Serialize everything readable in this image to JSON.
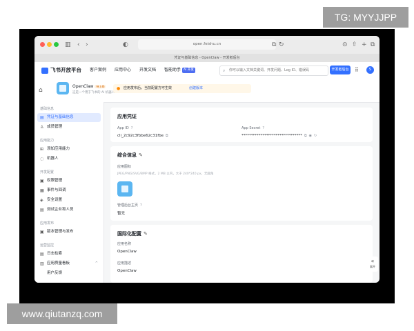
{
  "watermarks": {
    "top": "TG: MYYJJPP",
    "bottom": "www.qiutanzq.com"
  },
  "browser": {
    "url": "open.feishu.cn",
    "tab_title": "凭证与基础信息 - OpenClaw - 开发者后台",
    "icons": [
      "sidebar-icon",
      "back-icon",
      "forward-icon",
      "shield-icon",
      "translate-icon",
      "reload-icon",
      "download-icon",
      "share-icon",
      "new-tab-icon",
      "tabs-icon"
    ]
  },
  "header": {
    "logo": "飞书开放平台",
    "nav": [
      "客户案例",
      "应用中心",
      "开发文档",
      "智能助手"
    ],
    "ai_badge": "AI 开发",
    "search_placeholder": "你可以输入文档关键词、开发问题、Log ID、错误码",
    "console_button": "开发者后台",
    "avatar": "S"
  },
  "app": {
    "name": "OpenClaw",
    "tag": "待上线",
    "desc": "这是一个用于飞书的 AI 机器人",
    "notice": "应用发布后，当前配置方可生效",
    "notice_link": "创建版本"
  },
  "sidebar": {
    "groups": [
      {
        "title": "基础信息",
        "items": [
          {
            "label": "凭证与基础信息",
            "icon": "▤",
            "active": true
          },
          {
            "label": "成员管理",
            "icon": "♙"
          }
        ]
      },
      {
        "title": "应用能力",
        "items": [
          {
            "label": "添加应用能力",
            "icon": "⊞"
          },
          {
            "label": "机器人",
            "icon": "◌"
          }
        ]
      },
      {
        "title": "开发配置",
        "items": [
          {
            "label": "权限管理",
            "icon": "▣"
          },
          {
            "label": "事件与回调",
            "icon": "▦"
          },
          {
            "label": "安全设置",
            "icon": "◈"
          },
          {
            "label": "测试企业和人员",
            "icon": "▤"
          }
        ]
      },
      {
        "title": "应用发布",
        "items": [
          {
            "label": "版本管理与发布",
            "icon": "▣"
          }
        ]
      },
      {
        "title": "运营监控",
        "items": [
          {
            "label": "日志检索",
            "icon": "▤"
          },
          {
            "label": "应用质量看板",
            "icon": "▥",
            "chevron": "^"
          },
          {
            "label": "用户反馈",
            "icon": ""
          }
        ]
      }
    ]
  },
  "credentials": {
    "title": "应用凭证",
    "app_id_label": "App ID",
    "app_id_value": "cli_2c92c3fbbe62c31fbe",
    "app_secret_label": "App Secret",
    "app_secret_value": "********************************"
  },
  "general": {
    "title": "综合信息",
    "icon_label": "应用图标",
    "icon_hint": "JPEG/PNG/SVG/BMP 格式，2 MB 以内，大于 240*240 px，无圆角",
    "homepage_label": "管理后台主页",
    "homepage_value": "暂无"
  },
  "i18n": {
    "title": "国际化配置",
    "name_label": "应用名称",
    "name_value": "OpenClaw",
    "desc_label": "应用描述",
    "desc_value": "OpenClaw"
  },
  "expand_label": "展开"
}
